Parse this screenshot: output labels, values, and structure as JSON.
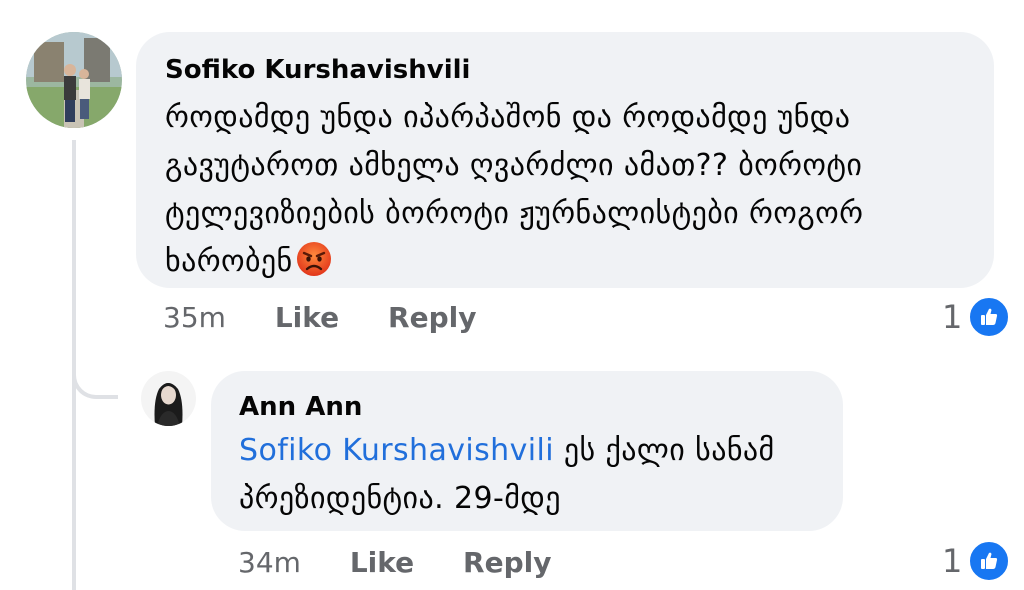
{
  "comments": [
    {
      "author": "Sofiko Kurshavishvili",
      "text_lines": [
        "როდამდე უნდა იპარპაშონ და როდამდე უნდა",
        "გავუტაროთ ამხელა ღვარძლი ამათ?? ბოროტი",
        "ტელევიზიების ბოროტი ჟურნალისტები როგორ",
        "ხარობენ"
      ],
      "emoji": "angry-face-icon",
      "time": "35m",
      "like_label": "Like",
      "reply_label": "Reply",
      "reaction_count": "1"
    },
    {
      "author": "Ann Ann",
      "mention": "Sofiko Kurshavishvili",
      "text_line1_rest": " ეს ქალი სანამ",
      "text_line2": "პრეზიდენტია. 29-მდე",
      "time": "34m",
      "like_label": "Like",
      "reply_label": "Reply",
      "reaction_count": "1"
    }
  ],
  "colors": {
    "bubble": "#f0f2f5",
    "mention": "#216fdb",
    "meta": "#65676b",
    "like": "#1877f2"
  }
}
